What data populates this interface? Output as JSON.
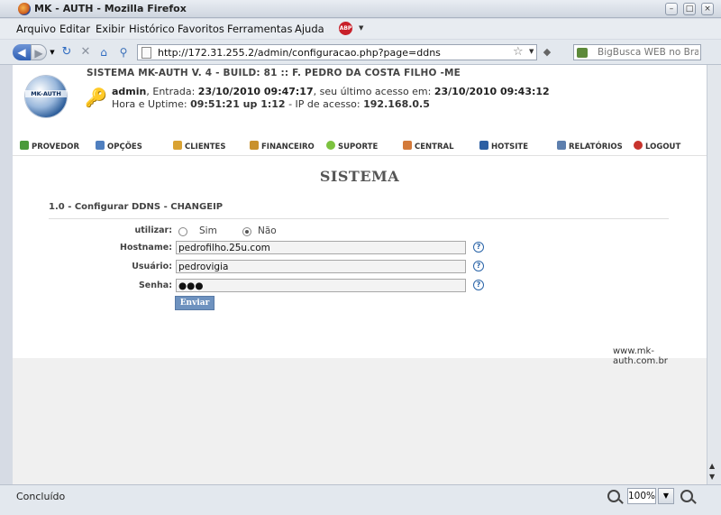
{
  "window": {
    "title": "MK - AUTH - Mozilla Firefox"
  },
  "menubar": [
    "Arquivo",
    "Editar",
    "Exibir",
    "Histórico",
    "Favoritos",
    "Ferramentas",
    "Ajuda"
  ],
  "addons": {
    "abp_label": "ABP"
  },
  "navbar": {
    "url": "http://172.31.255.2/admin/configuracao.php?page=ddns",
    "search_placeholder": "BigBusca WEB no Bras"
  },
  "header": {
    "logo_text": "MK-AUTH",
    "system_title": "SISTEMA MK-AUTH V. 4 - BUILD: 81 :: F. PEDRO DA COSTA FILHO -ME",
    "user": "admin",
    "login_label": ", Entrada: ",
    "login_time": "23/10/2010 09:47:17",
    "last_access_label": ", seu último acesso em: ",
    "last_access_time": "23/10/2010 09:43:12",
    "uptime_label": "Hora e Uptime: ",
    "uptime_value": "09:51:21 up 1:12",
    "ip_label": " - IP de acesso: ",
    "ip_value": "192.168.0.5"
  },
  "menu": [
    {
      "label": "PROVEDOR",
      "color": "#4a9a3a"
    },
    {
      "label": "OPÇÕES",
      "color": "#4f7fbf"
    },
    {
      "label": "CLIENTES",
      "color": "#d9a233"
    },
    {
      "label": "FINANCEIRO",
      "color": "#c9912c"
    },
    {
      "label": "SUPORTE",
      "color": "#7cc23f"
    },
    {
      "label": "CENTRAL",
      "color": "#d37a3a"
    },
    {
      "label": "HOTSITE",
      "color": "#2c5fa3"
    },
    {
      "label": "RELATÓRIOS",
      "color": "#5d7fae"
    },
    {
      "label": "LOGOUT",
      "color": "#c7332c"
    }
  ],
  "page": {
    "title": "SISTEMA",
    "section": "1.0 - Configurar DDNS - CHANGEIP"
  },
  "form": {
    "utilizar_label": "utilizar:",
    "sim_label": "Sim",
    "nao_label": "Não",
    "selected": "Não",
    "hostname_label": "Hostname:",
    "hostname_value": "pedrofilho.25u.com",
    "usuario_label": "Usuário:",
    "usuario_value": "pedrovigia",
    "senha_label": "Senha:",
    "senha_value": "●●●",
    "help_symbol": "?",
    "submit_label": "Enviar"
  },
  "footer": {
    "site": "www.mk-auth.com.br"
  },
  "statusbar": {
    "status": "Concluído",
    "zoom": "100%"
  }
}
